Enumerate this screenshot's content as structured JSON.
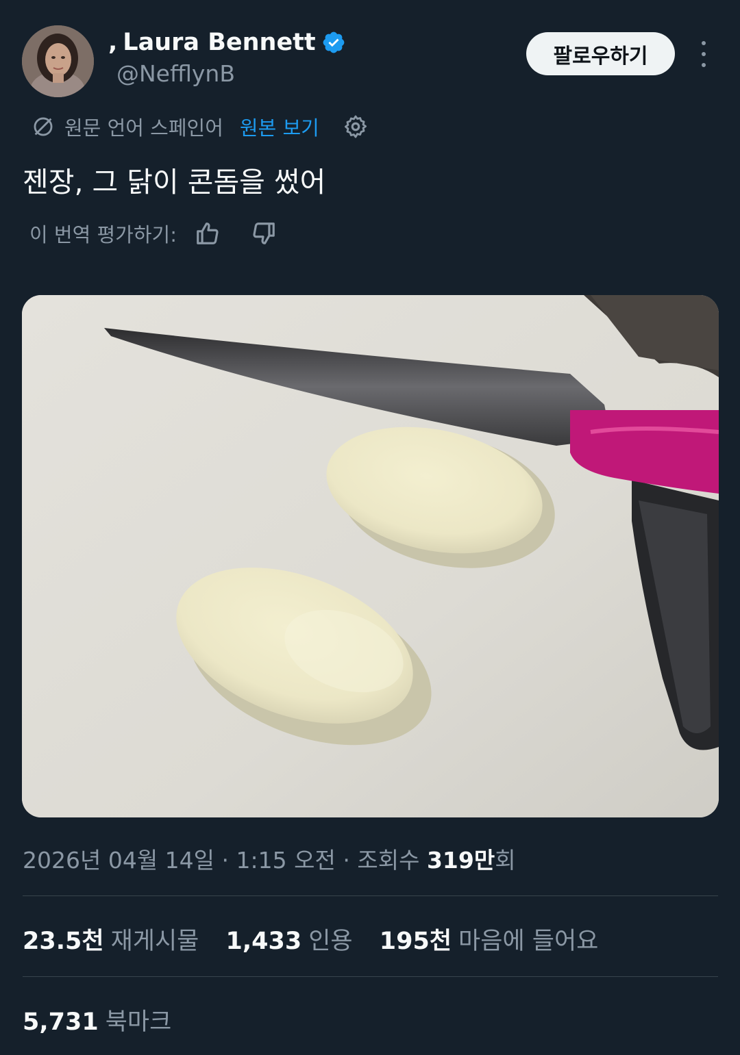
{
  "user": {
    "display_name": "Laura Bennett",
    "handle": "@NefflynB",
    "name_prefix": ","
  },
  "follow_label": "팔로우하기",
  "translation": {
    "source_language": "원문 언어 스페인어",
    "view_original": "원본 보기",
    "rate_label": "이 번역 평가하기:"
  },
  "tweet": {
    "text": "젠장, 그 닭이 콘돔을 썼어"
  },
  "meta": {
    "date": "2026년 04월 14일",
    "time": "1:15 오전",
    "views_prefix": "조회수",
    "views_value": "319만",
    "views_suffix": "회",
    "separator": "·"
  },
  "stats": {
    "reposts_value": "23.5천",
    "reposts_label": "재게시물",
    "quotes_value": "1,433",
    "quotes_label": "인용",
    "likes_value": "195천",
    "likes_label": "마음에 들어요",
    "bookmarks_value": "5,731",
    "bookmarks_label": "북마크"
  },
  "colors": {
    "background": "#15202b",
    "accent": "#1d9bf0",
    "muted": "#8b98a5"
  }
}
